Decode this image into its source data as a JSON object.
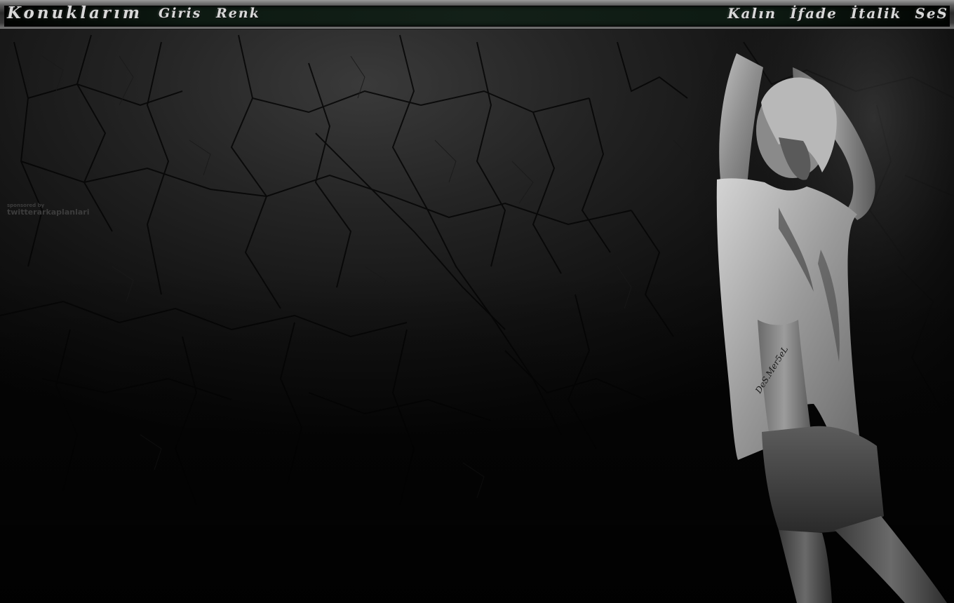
{
  "menu": {
    "left_items": [
      "Konuklarım",
      "Giris",
      "Renk"
    ],
    "right_items": [
      "Kalın",
      "İfade",
      "İtalik",
      "SeS"
    ]
  },
  "watermark": {
    "line1": "sponsored by",
    "line2": "twitterarkaplanlari"
  },
  "signature": "DeS.Mer5eL",
  "colors": {
    "menu_text": "#d8d8d8",
    "menu_bar_inner": "#132018",
    "background": "#0a0a0a"
  }
}
